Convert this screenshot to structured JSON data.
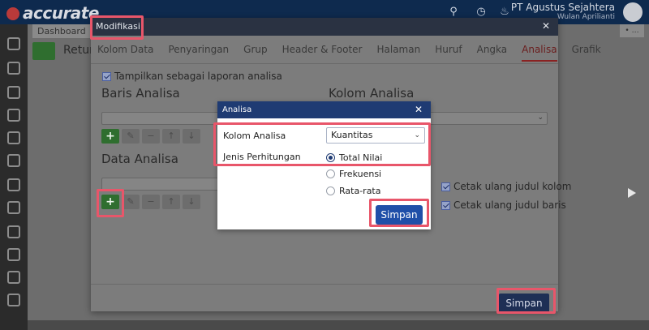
{
  "app": {
    "logo_text": "accurate",
    "company_name": "PT Agustus Sejahtera",
    "company_sub": "Wulan Aprilianti",
    "background_tab": "Dashboard",
    "background_page": "Retur",
    "right_button": "• …"
  },
  "modal": {
    "title": "Modifikasi",
    "close": "✕",
    "tabs": [
      {
        "label": "Kolom Data"
      },
      {
        "label": "Penyaringan"
      },
      {
        "label": "Grup"
      },
      {
        "label": "Header & Footer"
      },
      {
        "label": "Halaman"
      },
      {
        "label": "Huruf"
      },
      {
        "label": "Angka"
      },
      {
        "label": "Analisa",
        "active": true
      },
      {
        "label": "Grafik"
      }
    ],
    "show_analysis_label": "Tampilkan sebagai laporan analisa",
    "baris_title": "Baris Analisa",
    "kolom_title": "Kolom Analisa",
    "data_title": "Data Analisa",
    "btn_add": "+",
    "btn_edit": "✎",
    "btn_remove": "−",
    "btn_up": "↑",
    "btn_down": "↓",
    "chevron": "⌄",
    "checkboxes": [
      {
        "label": "Cetak ulang judul kolom",
        "checked": true
      },
      {
        "label": "Cetak ulang judul baris",
        "checked": true
      }
    ],
    "save_label": "Simpan"
  },
  "dialog": {
    "title": "Analisa",
    "close": "✕",
    "kolom_label": "Kolom Analisa",
    "kolom_value": "Kuantitas",
    "chevron": "⌄",
    "jenis_label": "Jenis Perhitungan",
    "options": [
      {
        "label": "Total Nilai",
        "selected": true
      },
      {
        "label": "Frekuensi",
        "selected": false
      },
      {
        "label": "Rata-rata",
        "selected": false
      }
    ],
    "save_label": "Simpan"
  },
  "colors": {
    "highlight": "#e8566a",
    "dialog_header": "#1f3b73",
    "primary_button": "#1f4fa8"
  }
}
